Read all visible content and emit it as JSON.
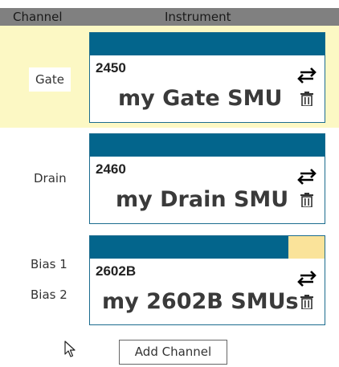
{
  "header": {
    "channel_label": "Channel",
    "instrument_label": "Instrument"
  },
  "rows": [
    {
      "channels": [
        "Gate"
      ],
      "selected": true,
      "instrument": {
        "model": "2450",
        "name": "my Gate SMU",
        "swap_icon": "swap-arrows-icon",
        "delete_icon": "trash-icon"
      }
    },
    {
      "channels": [
        "Drain"
      ],
      "selected": false,
      "instrument": {
        "model": "2460",
        "name": "my Drain SMU",
        "swap_icon": "swap-arrows-icon",
        "delete_icon": "trash-icon"
      }
    },
    {
      "channels": [
        "Bias 1",
        "Bias 2"
      ],
      "selected": false,
      "instrument": {
        "model": "2602B",
        "name": "my 2602B SMUs",
        "swap_icon": "swap-arrows-icon",
        "delete_icon": "trash-icon"
      }
    }
  ],
  "add_channel_button": "Add Channel",
  "colors": {
    "header_bg": "#808080",
    "selected_row_bg": "#fcf8c4",
    "card_bar": "#03658c",
    "card_bar_partial": "#fae39a",
    "card_border": "#1c6c8e"
  }
}
